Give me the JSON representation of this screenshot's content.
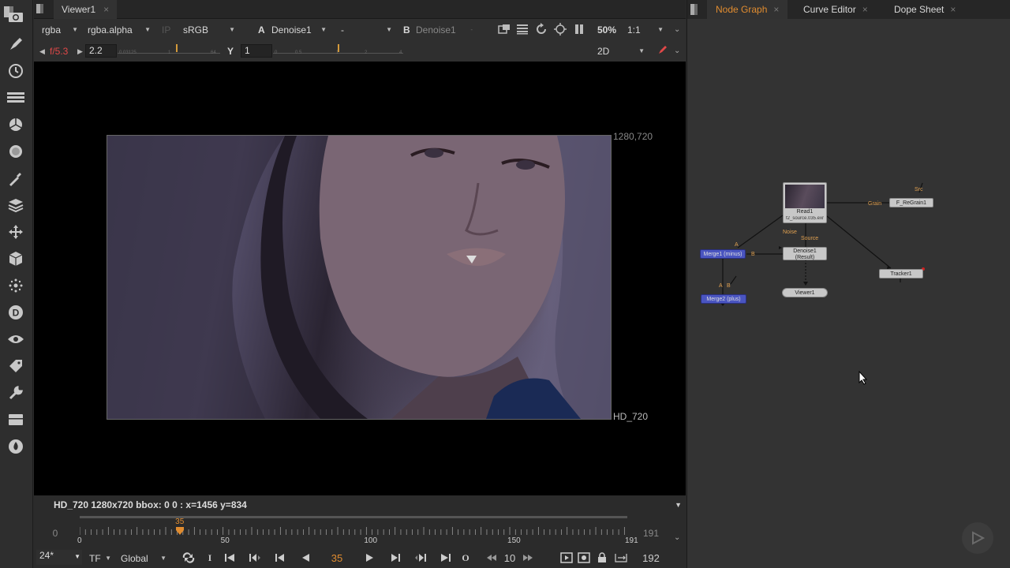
{
  "toolbar": {
    "tools": [
      "image-icon",
      "draw-icon",
      "time-icon",
      "channel-icon",
      "color-icon",
      "filter-icon",
      "keyer-icon",
      "merge-icon",
      "transform-icon",
      "3d-icon",
      "particles-icon",
      "deep-icon",
      "views-icon",
      "metadata-icon",
      "toolsets-icon",
      "other-icon",
      "furnace-icon"
    ]
  },
  "viewer": {
    "tab_label": "Viewer1",
    "tab_close": "×",
    "channels": "rgba",
    "alpha_channel": "rgba.alpha",
    "ip_label": "IP",
    "colorspace": "sRGB",
    "a_label": "A",
    "a_input": "Denoise1",
    "dash": "-",
    "b_label": "B",
    "b_input": "Denoise1",
    "zoom": "50%",
    "ratio": "1:1",
    "fstop": "f/5.3",
    "gain": "2.2",
    "gain_ticks": [
      "0.03125",
      "1",
      "64"
    ],
    "y_label": "Y",
    "gamma": "1",
    "gamma_ticks": [
      "0",
      "0.5",
      "1",
      "2",
      "4"
    ],
    "mode": "2D",
    "format_top": "1280,720",
    "format_bottom": "HD_720",
    "info": "HD_720 1280x720  bbox: 0 0 :  x=1456 y=834"
  },
  "timeline": {
    "start_frame": "0",
    "end_frame": "191",
    "current_frame": "35",
    "labels": [
      "0",
      "50",
      "100",
      "150",
      "191"
    ],
    "range_start": 0,
    "range_end": 191
  },
  "playbar": {
    "fps": "24*",
    "tf": "TF",
    "scope": "Global",
    "in_label": "I",
    "out_label": "O",
    "frame": "35",
    "increment": "10",
    "last_frame": "192"
  },
  "nodegraph": {
    "tabs": [
      {
        "label": "Node Graph",
        "color": "#e08c30"
      },
      {
        "label": "Curve Editor",
        "color": "#d8d8d8"
      },
      {
        "label": "Dope Sheet",
        "color": "#d8d8d8"
      }
    ],
    "close": "×",
    "nodes": {
      "read": {
        "name": "Read1",
        "file": "f2_source.035.exr"
      },
      "regrain": "F_ReGrain1",
      "denoise": {
        "name": "Denoise1",
        "sub": "(Result)"
      },
      "merge1": "Merge1 (minus)",
      "merge2": "Merge2 (plus)",
      "viewer": "Viewer1",
      "tracker": "Tracker1"
    },
    "edge_labels": {
      "src": "Src",
      "grain": "Grain",
      "noise": "Noise",
      "source": "Source",
      "a1": "A",
      "b1": "B",
      "a2": "A",
      "b2": "B"
    }
  }
}
